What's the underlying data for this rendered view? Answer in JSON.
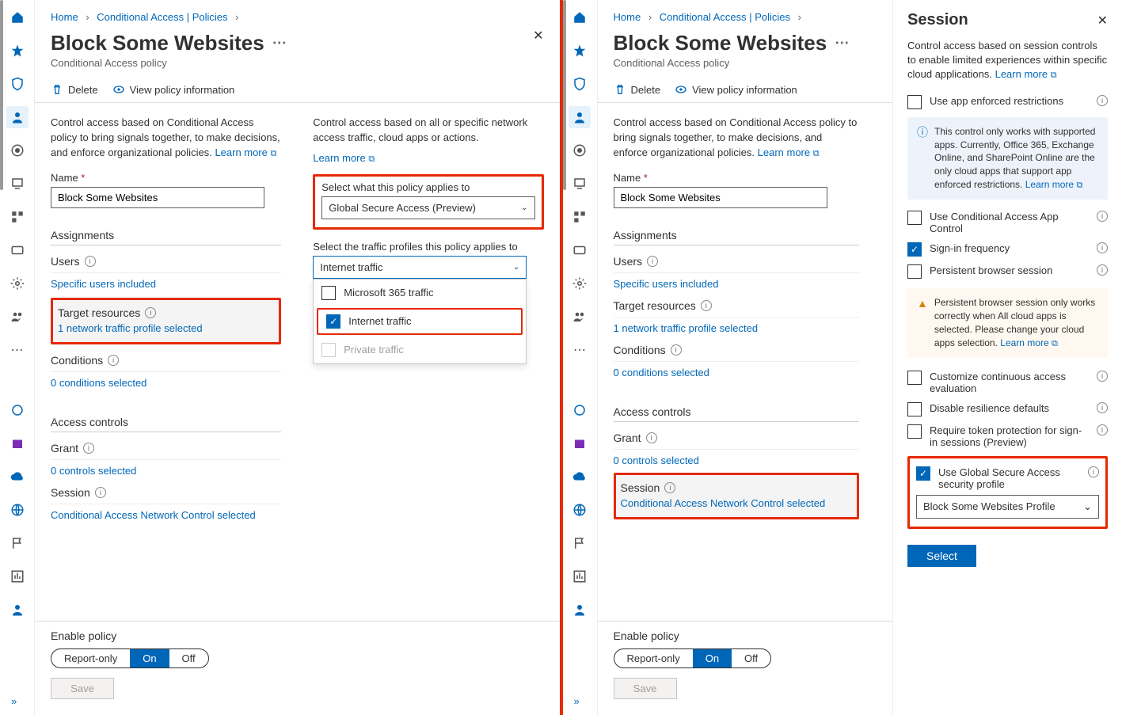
{
  "breadcrumbs": {
    "home": "Home",
    "policies": "Conditional Access | Policies"
  },
  "title": "Block Some Websites",
  "subtitle": "Conditional Access policy",
  "toolbar": {
    "delete": "Delete",
    "view": "View policy information"
  },
  "left": {
    "desc": "Control access based on Conditional Access policy to bring signals together, to make decisions, and enforce organizational policies.",
    "learn": "Learn more",
    "name_label": "Name",
    "name_value": "Block Some Websites",
    "assignments": "Assignments",
    "users": "Users",
    "users_val": "Specific users included",
    "target": "Target resources",
    "target_val": "1 network traffic profile selected",
    "cond": "Conditions",
    "cond_val": "0 conditions selected",
    "ac": "Access controls",
    "grant": "Grant",
    "grant_val": "0 controls selected",
    "sess": "Session",
    "sess_val": "Conditional Access Network Control selected"
  },
  "right_col": {
    "desc": "Control access based on all or specific network access traffic, cloud apps or actions.",
    "learn": "Learn more",
    "apply_label": "Select what this policy applies to",
    "apply_value": "Global Secure Access (Preview)",
    "traffic_label": "Select the traffic profiles this policy applies to",
    "traffic_value": "Internet traffic",
    "opts": {
      "m365": "Microsoft 365 traffic",
      "internet": "Internet traffic",
      "private": "Private traffic"
    }
  },
  "footer": {
    "enable": "Enable policy",
    "report": "Report-only",
    "on": "On",
    "off": "Off",
    "save": "Save"
  },
  "session": {
    "title": "Session",
    "desc": "Control access based on session controls to enable limited experiences within specific cloud applications.",
    "learn": "Learn more",
    "c1": "Use app enforced restrictions",
    "callout": "This control only works with supported apps. Currently, Office 365, Exchange Online, and SharePoint Online are the only cloud apps that support app enforced restrictions.",
    "callout_learn": "Learn more",
    "c2": "Use Conditional Access App Control",
    "c3": "Sign-in frequency",
    "c4": "Persistent browser session",
    "warn": "Persistent browser session only works correctly when All cloud apps is selected. Please change your cloud apps selection.",
    "warn_learn": "Learn more",
    "c5": "Customize continuous access evaluation",
    "c6": "Disable resilience defaults",
    "c7": "Require token protection for sign-in sessions (Preview)",
    "c8": "Use Global Secure Access security profile",
    "profile": "Block Some Websites Profile",
    "select_btn": "Select"
  }
}
